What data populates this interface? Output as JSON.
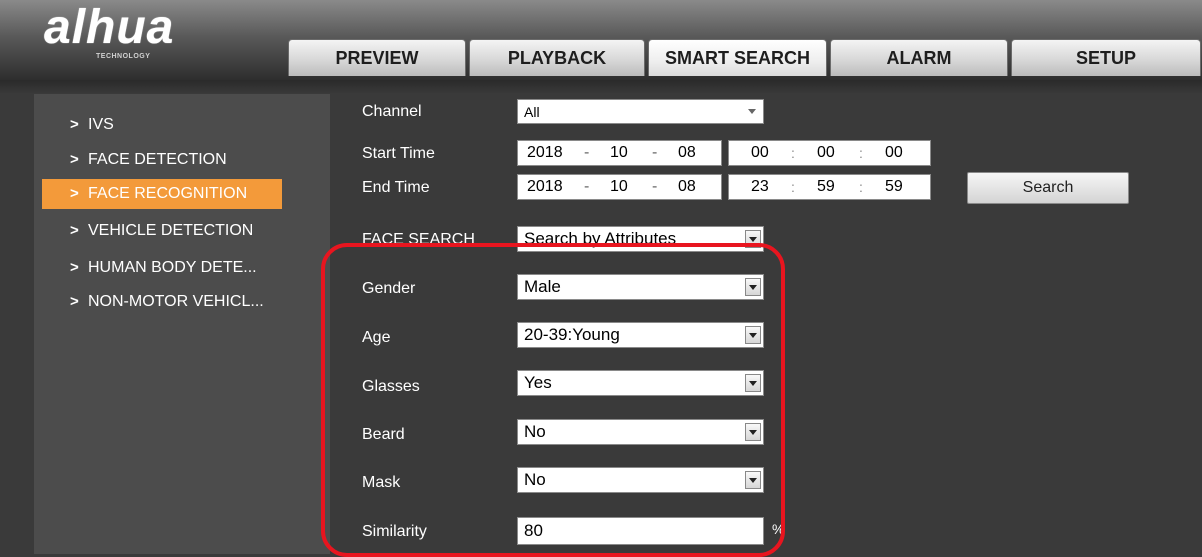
{
  "brand": {
    "logo": "alhua",
    "sub": "TECHNOLOGY"
  },
  "tabs": [
    {
      "label": "PREVIEW"
    },
    {
      "label": "PLAYBACK"
    },
    {
      "label": "SMART SEARCH"
    },
    {
      "label": "ALARM"
    },
    {
      "label": "SETUP"
    }
  ],
  "active_tab": "SMART SEARCH",
  "sidebar": {
    "chevron": ">",
    "items": [
      {
        "label": "IVS"
      },
      {
        "label": "FACE DETECTION"
      },
      {
        "label": "FACE RECOGNITION"
      },
      {
        "label": "VEHICLE DETECTION"
      },
      {
        "label": "HUMAN BODY DETE..."
      },
      {
        "label": "NON-MOTOR VEHICL..."
      }
    ],
    "active_item": "FACE RECOGNITION"
  },
  "form": {
    "channel": {
      "label": "Channel",
      "value": "All"
    },
    "start_time": {
      "label": "Start Time",
      "year": "2018",
      "month": "10",
      "day": "08",
      "hour": "00",
      "minute": "00",
      "second": "00"
    },
    "end_time": {
      "label": "End Time",
      "year": "2018",
      "month": "10",
      "day": "08",
      "hour": "23",
      "minute": "59",
      "second": "59"
    },
    "search_label": "Search",
    "date_sep": "-",
    "time_sep": ":",
    "face_search": {
      "label": "FACE SEARCH",
      "value": "Search by Attributes"
    },
    "attributes": {
      "gender": {
        "label": "Gender",
        "value": "Male"
      },
      "age": {
        "label": "Age",
        "value": "20-39:Young"
      },
      "glasses": {
        "label": "Glasses",
        "value": "Yes"
      },
      "beard": {
        "label": "Beard",
        "value": "No"
      },
      "mask": {
        "label": "Mask",
        "value": "No"
      },
      "similarity": {
        "label": "Similarity",
        "value": "80",
        "unit": "%"
      }
    }
  },
  "colors": {
    "accent": "#f39a3a",
    "highlight": "#e8151f",
    "background": "#3a3a3a",
    "sidebar": "#4c4c4c"
  }
}
